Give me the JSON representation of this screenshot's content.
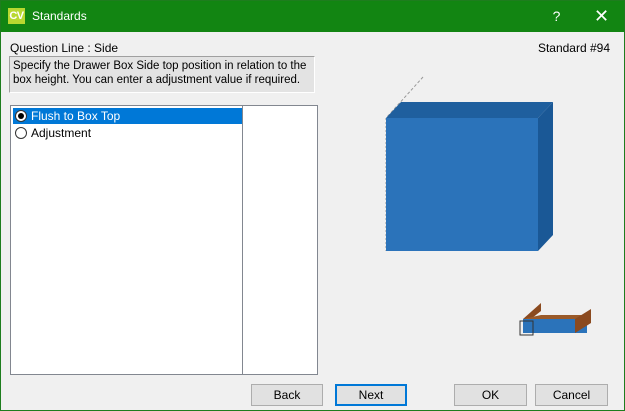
{
  "window": {
    "app_icon_text": "CV",
    "title": "Standards",
    "help_label": "?",
    "close_label": "✕"
  },
  "question_line": "Question Line : Side",
  "standard_number": "Standard #94",
  "description": "Specify the Drawer Box Side top position in relation to the box height. You can enter a adjustment value if required.",
  "options": [
    {
      "label": "Flush to Box Top",
      "selected": true
    },
    {
      "label": "Adjustment",
      "selected": false
    }
  ],
  "buttons": {
    "back": "Back",
    "next": "Next",
    "ok": "OK",
    "cancel": "Cancel"
  },
  "colors": {
    "titlebar": "#128512",
    "box_front": "#2b73ba",
    "box_top": "#1f5f9e",
    "box_side": "#1a5896",
    "drawer_wood": "#8b4a1f",
    "selection": "#0078d7"
  }
}
